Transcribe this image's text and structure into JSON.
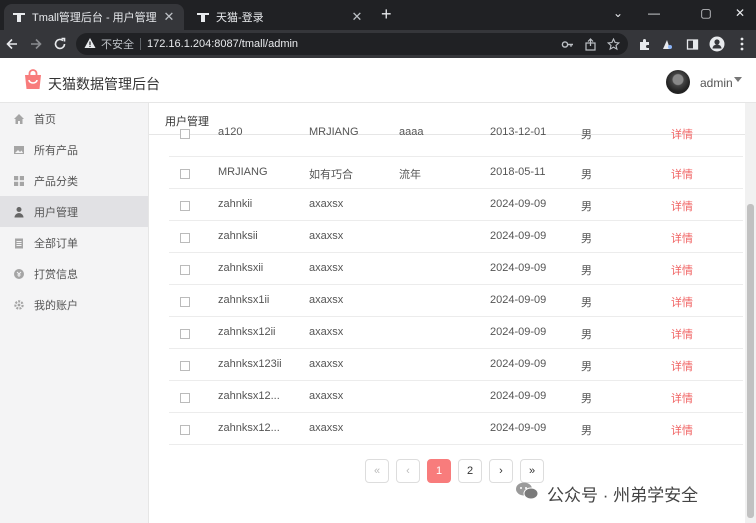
{
  "browser": {
    "tabs": [
      {
        "title": "Tmall管理后台 - 用户管理",
        "active": true
      },
      {
        "title": "天猫-登录",
        "active": false
      }
    ],
    "insecure_label": "不安全",
    "url": "172.16.1.204:8087/tmall/admin",
    "icons": [
      "back-icon",
      "forward-icon",
      "reload-icon",
      "warning-icon",
      "key-icon",
      "share-icon",
      "star-icon",
      "extensions-icon",
      "profile-icon",
      "menu-icon"
    ]
  },
  "header": {
    "brand": "天猫数据管理后台",
    "user": "admin"
  },
  "sidebar": {
    "items": [
      {
        "label": "首页",
        "icon": "home-icon",
        "active": false
      },
      {
        "label": "所有产品",
        "icon": "image-icon",
        "active": false
      },
      {
        "label": "产品分类",
        "icon": "grid-icon",
        "active": false
      },
      {
        "label": "用户管理",
        "icon": "user-icon",
        "active": true
      },
      {
        "label": "全部订单",
        "icon": "clipboard-icon",
        "active": false
      },
      {
        "label": "打赏信息",
        "icon": "coin-icon",
        "active": false
      },
      {
        "label": "我的账户",
        "icon": "gear-icon",
        "active": false
      }
    ]
  },
  "main": {
    "page_title": "用户管理",
    "table": {
      "rows": [
        {
          "name": "a120",
          "nickname": "MRJIANG",
          "realname": "aaaa",
          "date": "2013-12-01",
          "gender": "男",
          "action": "详情"
        },
        {
          "name": "MRJIANG",
          "nickname": "如有巧合",
          "realname": "流年",
          "date": "2018-05-11",
          "gender": "男",
          "action": "详情"
        },
        {
          "name": "zahnkii",
          "nickname": "axaxsx",
          "realname": "",
          "date": "2024-09-09",
          "gender": "男",
          "action": "详情"
        },
        {
          "name": "zahnksii",
          "nickname": "axaxsx",
          "realname": "",
          "date": "2024-09-09",
          "gender": "男",
          "action": "详情"
        },
        {
          "name": "zahnksxii",
          "nickname": "axaxsx",
          "realname": "",
          "date": "2024-09-09",
          "gender": "男",
          "action": "详情"
        },
        {
          "name": "zahnksx1ii",
          "nickname": "axaxsx",
          "realname": "",
          "date": "2024-09-09",
          "gender": "男",
          "action": "详情"
        },
        {
          "name": "zahnksx12ii",
          "nickname": "axaxsx",
          "realname": "",
          "date": "2024-09-09",
          "gender": "男",
          "action": "详情"
        },
        {
          "name": "zahnksx123ii",
          "nickname": "axaxsx",
          "realname": "",
          "date": "2024-09-09",
          "gender": "男",
          "action": "详情"
        },
        {
          "name": "zahnksx12...",
          "nickname": "axaxsx",
          "realname": "",
          "date": "2024-09-09",
          "gender": "男",
          "action": "详情"
        },
        {
          "name": "zahnksx12...",
          "nickname": "axaxsx",
          "realname": "",
          "date": "2024-09-09",
          "gender": "男",
          "action": "详情"
        }
      ]
    },
    "pagination": {
      "first": "«",
      "prev": "‹",
      "pages": [
        "1",
        "2"
      ],
      "current": "1",
      "next": "›",
      "last": "»"
    }
  },
  "watermark": {
    "text": "公众号 · 州弟学安全"
  },
  "colors": {
    "accent": "#f87c7c",
    "link": "#f06262"
  }
}
